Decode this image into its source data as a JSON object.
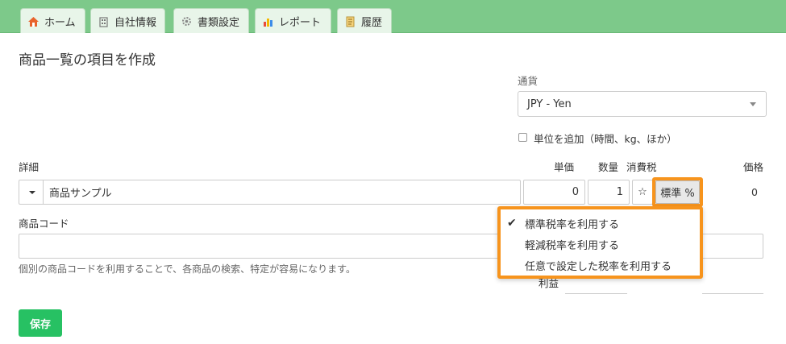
{
  "nav": {
    "tabs": [
      {
        "label": "ホーム",
        "icon": "home-icon"
      },
      {
        "label": "自社情報",
        "icon": "building-icon"
      },
      {
        "label": "書類設定",
        "icon": "gear-icon"
      },
      {
        "label": "レポート",
        "icon": "chart-icon"
      },
      {
        "label": "履歴",
        "icon": "history-icon"
      }
    ]
  },
  "page": {
    "title": "商品一覧の項目を作成"
  },
  "currency": {
    "label": "通貨",
    "value": "JPY - Yen"
  },
  "unit_option": {
    "label": "単位を追加（時間、kg、ほか）"
  },
  "columns": {
    "detail": "詳細",
    "unit_price": "単価",
    "quantity": "数量",
    "tax": "消費税",
    "price": "価格"
  },
  "item": {
    "name": "商品サンプル",
    "unit_price": "0",
    "quantity": "1",
    "tax_star": "☆",
    "tax_label": "標準 %",
    "price": "0"
  },
  "tax_menu": {
    "items": [
      {
        "label": "標準税率を利用する",
        "checked": true
      },
      {
        "label": "軽減税率を利用する",
        "checked": false
      },
      {
        "label": "任意で設定した税率を利用する",
        "checked": false
      }
    ]
  },
  "product_code": {
    "label": "商品コード",
    "value": "",
    "help": "個別の商品コードを利用することで、各商品の検索、特定が容易になります。"
  },
  "profit": {
    "label": "利益"
  },
  "save_label": "保存",
  "colors": {
    "accent": "#27c163",
    "nav_bg": "#7dc98a",
    "highlight": "#f7941d"
  }
}
